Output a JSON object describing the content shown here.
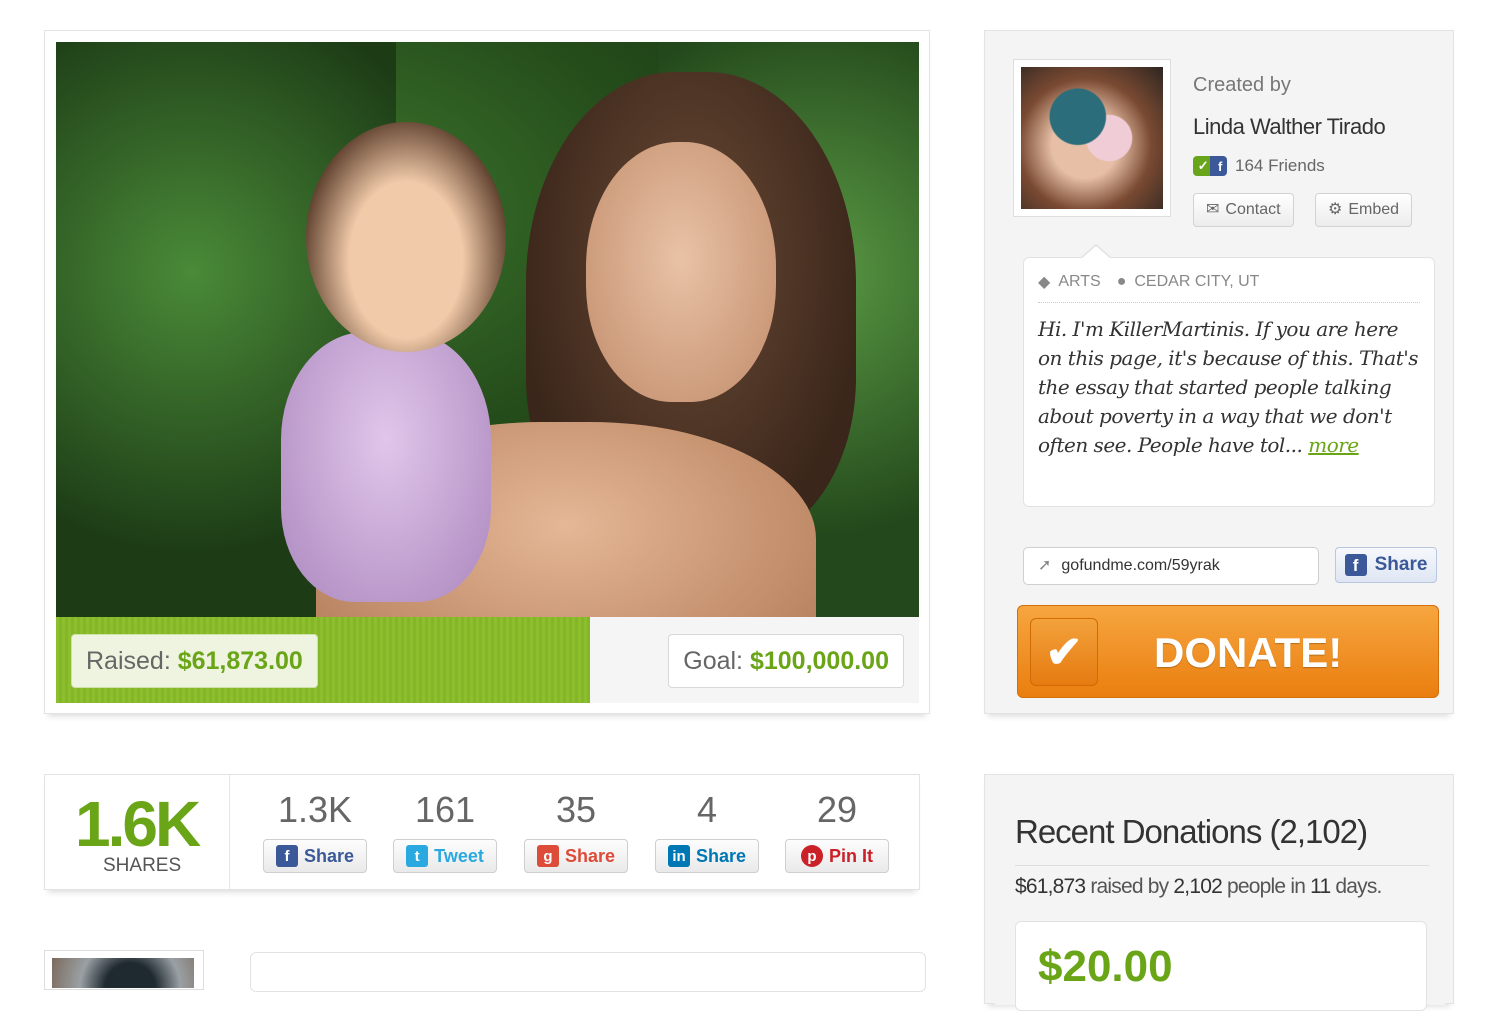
{
  "campaign": {
    "photo_alt": "",
    "raised_label": "Raised:",
    "raised_amount": "$61,873.00",
    "goal_label": "Goal:",
    "goal_amount": "$100,000.00",
    "progress_fraction": 0.619
  },
  "creator": {
    "created_by_label": "Created by",
    "name": "Linda Walther Tirado",
    "friends": "164 Friends",
    "contact_label": "Contact",
    "embed_label": "Embed"
  },
  "story": {
    "category": "ARTS",
    "location": "CEDAR CITY, UT",
    "text": "Hi. I'm KillerMartinis. If you are here on this page, it's because of this. That's the essay that started people talking about poverty in a way that we don't often see. People have tol... ",
    "more_label": "more"
  },
  "share_url": {
    "url": "gofundme.com/59yrak",
    "share_label": "Share"
  },
  "donate": {
    "label": "DONATE!"
  },
  "shares": {
    "total": "1.6K",
    "total_label": "SHARES",
    "items": [
      {
        "count": "1.3K",
        "label": "Share",
        "network": "facebook",
        "color": "#3b5998"
      },
      {
        "count": "161",
        "label": "Tweet",
        "network": "twitter",
        "color": "#2aa9e0"
      },
      {
        "count": "35",
        "label": "Share",
        "network": "google-plus",
        "color": "#dd4b39"
      },
      {
        "count": "4",
        "label": "Share",
        "network": "linkedin",
        "color": "#0077b5"
      },
      {
        "count": "29",
        "label": "Pin It",
        "network": "pinterest",
        "color": "#cb2027"
      }
    ]
  },
  "donations": {
    "title": "Recent Donations (2,102)",
    "summary_amount": "$61,873",
    "summary_raised_by": "raised by",
    "summary_people": "2,102",
    "summary_people_in": "people in",
    "summary_days": "11",
    "summary_days_label": "days.",
    "first_amount": "$20.00"
  },
  "colors": {
    "accent_green": "#6aa517",
    "donate_orange": "#ea7e0f"
  }
}
